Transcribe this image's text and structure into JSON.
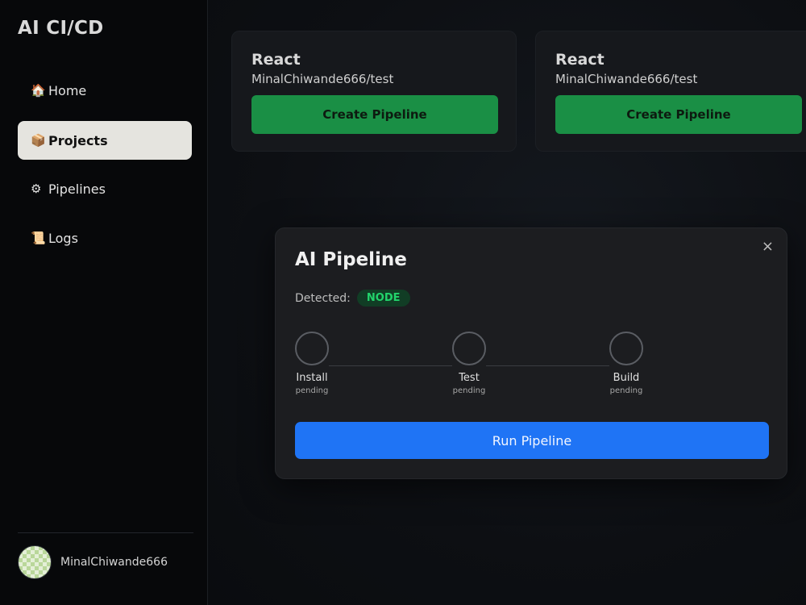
{
  "sidebar": {
    "brand": "AI CI/CD",
    "items": [
      {
        "icon": "🏠",
        "label": "Home"
      },
      {
        "icon": "📦",
        "label": "Projects"
      },
      {
        "icon": "⚙",
        "label": "Pipelines"
      },
      {
        "icon": "📜",
        "label": "Logs"
      }
    ],
    "user": {
      "name": "MinalChiwande666"
    }
  },
  "projects": [
    {
      "name": "React",
      "repo": "MinalChiwande666/test",
      "button": "Create Pipeline"
    },
    {
      "name": "React",
      "repo": "MinalChiwande666/test",
      "button": "Create Pipeline"
    }
  ],
  "modal": {
    "title": "AI Pipeline",
    "close": "×",
    "detected_label": "Detected:",
    "detected_value": "NODE",
    "steps": [
      {
        "label": "Install",
        "status": "pending"
      },
      {
        "label": "Test",
        "status": "pending"
      },
      {
        "label": "Build",
        "status": "pending"
      }
    ],
    "run_label": "Run Pipeline"
  },
  "colors": {
    "accent_green": "#1a8f45",
    "accent_blue": "#1f74f5",
    "badge_green": "#22d36b",
    "active_nav": "#e5e4df"
  }
}
